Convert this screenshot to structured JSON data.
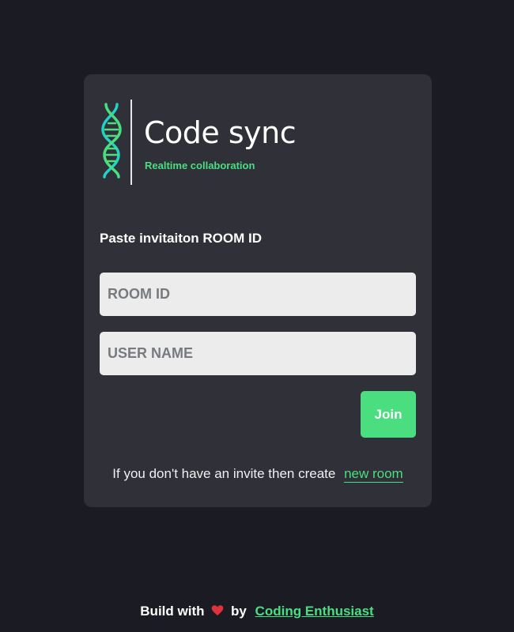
{
  "brand": {
    "title": "Code sync",
    "subtitle": "Realtime collaboration",
    "logo_icon": "dna-icon",
    "accent_color": "#4ade80"
  },
  "form": {
    "label": "Paste invitaiton ROOM ID",
    "room_id_placeholder": "ROOM ID",
    "room_id_value": "",
    "username_placeholder": "USER NAME",
    "username_value": "",
    "join_label": "Join"
  },
  "info": {
    "text": "If you don't have an invite then create",
    "link_text": "new room"
  },
  "footer": {
    "prefix": "Build with",
    "heart_icon": "heart-icon",
    "by": "by",
    "author_link": "Coding Enthusiast"
  }
}
